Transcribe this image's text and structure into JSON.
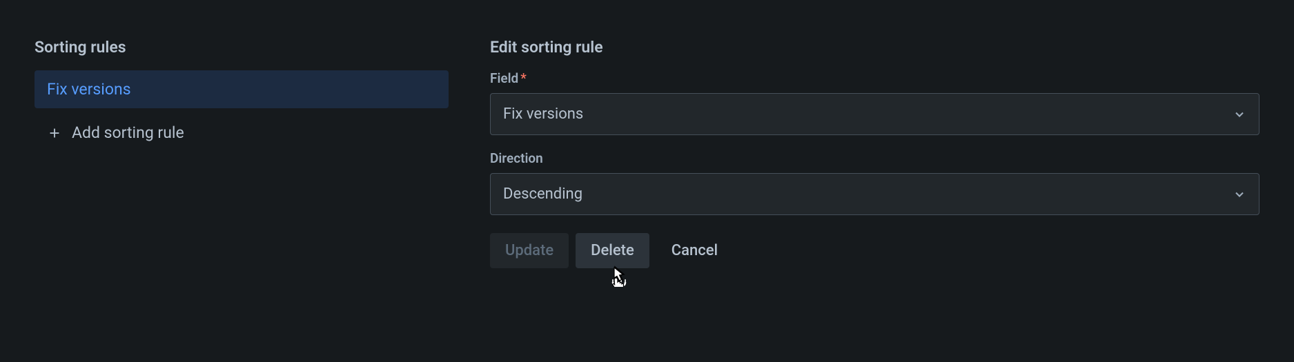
{
  "leftPanel": {
    "title": "Sorting rules",
    "selectedRule": "Fix versions",
    "addButtonLabel": "Add sorting rule"
  },
  "rightPanel": {
    "title": "Edit sorting rule",
    "fieldLabel": "Field",
    "fieldValue": "Fix versions",
    "directionLabel": "Direction",
    "directionValue": "Descending",
    "buttons": {
      "update": "Update",
      "delete": "Delete",
      "cancel": "Cancel"
    }
  }
}
